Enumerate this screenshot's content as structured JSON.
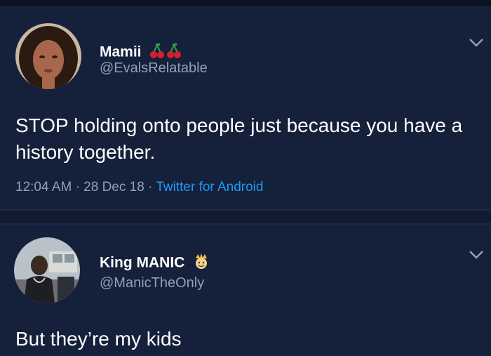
{
  "tweets": [
    {
      "display_name": "Mamii",
      "name_emoji": "cherries-icon x2",
      "handle": "@EvalsRelatable",
      "text": "STOP holding onto people just because you have a history together.",
      "time": "12:04 AM",
      "date": "28 Dec 18",
      "source": "Twitter for Android",
      "separator": "·"
    },
    {
      "display_name": "King MANIC",
      "name_emoji": "crown-face-icon",
      "handle": "@ManicTheOnly",
      "text": "But they’re my kids"
    }
  ],
  "colors": {
    "background": "#15203b",
    "text": "#ffffff",
    "secondary": "#8ea1bb",
    "link": "#1d9bf0"
  }
}
